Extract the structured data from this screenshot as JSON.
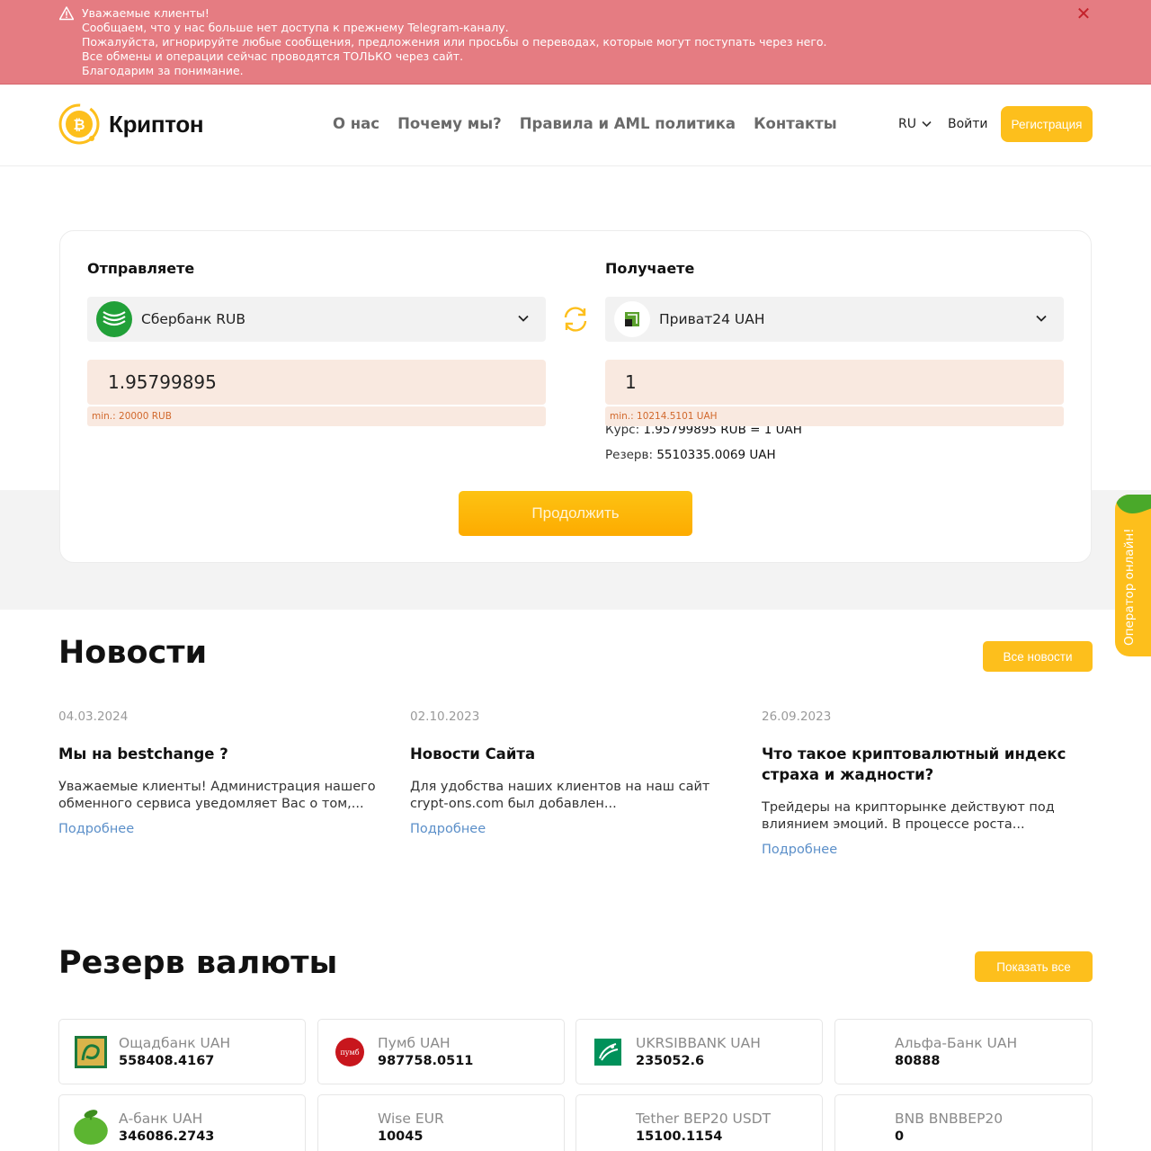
{
  "alert": {
    "lines": [
      "Уважаемые клиенты!",
      "Сообщаем, что у нас больше нет доступа к прежнему Telegram-каналу.",
      "Пожалуйста, игнорируйте любые сообщения, предложения или просьбы о переводах, которые могут поступать через него.",
      "Все обмены и операции сейчас проводятся ТОЛЬКО через сайт.",
      "Благодарим за понимание."
    ],
    "close": "✕"
  },
  "header": {
    "brand": "Криптон",
    "nav": [
      "О нас",
      "Почему мы?",
      "Правила и AML политика",
      "Контакты"
    ],
    "lang": "RU",
    "login": "Войти",
    "register": "Регистрация"
  },
  "exchange": {
    "send_title": "Отправляете",
    "receive_title": "Получаете",
    "send_currency": "Сбербанк RUB",
    "receive_currency": "Приват24 UAH",
    "send_amount": "1.95799895",
    "receive_amount": "1",
    "send_min": "min.: 20000 RUB",
    "receive_min": "min.: 10214.5101 UAH",
    "rate_label": "Курс:",
    "rate_value": "1.95799895 RUB = 1 UAH",
    "reserve_label": "Резерв:",
    "reserve_value": "5510335.0069 UAH",
    "continue": "Продолжить"
  },
  "operator": "Оператор онлайн!",
  "news": {
    "title": "Новости",
    "all": "Все новости",
    "items": [
      {
        "date": "04.03.2024",
        "title": "Мы на bestchange ?",
        "text": "Уважаемые клиенты! Администрация нашего обменного сервиса уведомляет Вас о том,...",
        "more": "Подробнее"
      },
      {
        "date": "02.10.2023",
        "title": "Новости Сайта",
        "text": "Для удобства наших клиентов на наш сайт crypt-ons.com был добавлен...",
        "more": "Подробнее"
      },
      {
        "date": "26.09.2023",
        "title": "Что такое криптовалютный индекс страха и жадности?",
        "text": "Трейдеры на крипторынке действуют под влиянием эмоций. В процессе роста...",
        "more": "Подробнее"
      }
    ]
  },
  "reserves": {
    "title": "Резерв валюты",
    "show_all": "Показать все",
    "items": [
      {
        "name": "Ощадбанк UAH",
        "value": "558408.4167",
        "icon": "oschadbank-icon"
      },
      {
        "name": "Пумб UAH",
        "value": "987758.0511",
        "icon": "pumb-icon"
      },
      {
        "name": "UKRSIBBANK UAH",
        "value": "235052.6",
        "icon": "ukrsibbank-icon"
      },
      {
        "name": "Альфа-Банк UAH",
        "value": "80888",
        "icon": "alfabank-icon"
      },
      {
        "name": "А-банк UAH",
        "value": "346086.2743",
        "icon": "abank-icon"
      },
      {
        "name": "Wise EUR",
        "value": "10045",
        "icon": "wise-icon"
      },
      {
        "name": "Tether BEP20 USDT",
        "value": "15100.1154",
        "icon": "tether-icon"
      },
      {
        "name": "BNB BNBBEP20",
        "value": "0",
        "icon": "bnb-icon"
      }
    ]
  },
  "colors": {
    "accent": "#fdbf1c",
    "alert_bg": "#e57c82",
    "link": "#5b8fc9",
    "input_bg": "#f9e9e0"
  }
}
